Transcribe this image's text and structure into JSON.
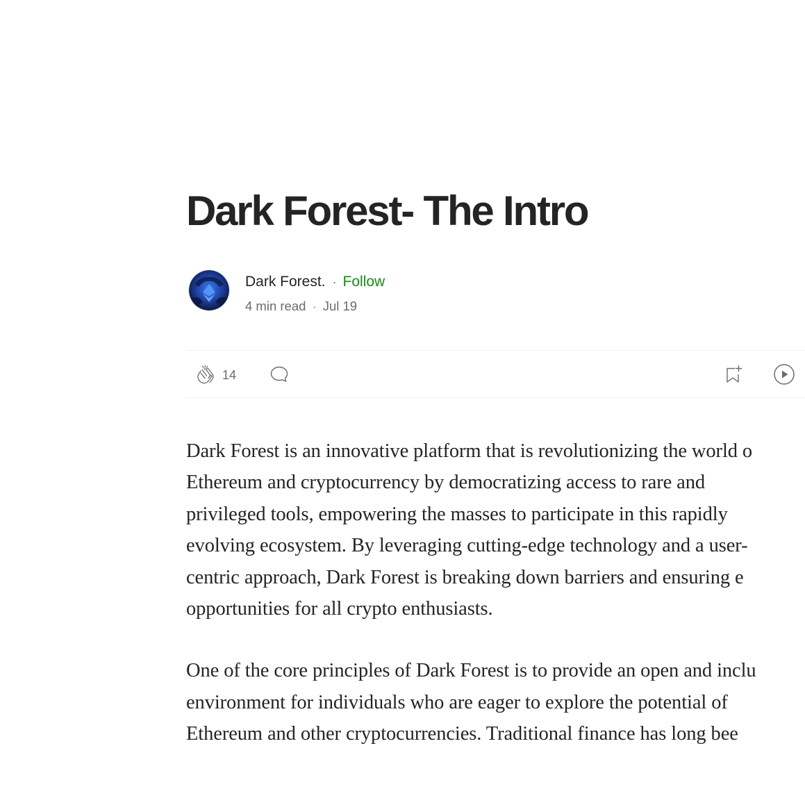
{
  "article": {
    "title": "Dark Forest- The Intro",
    "author": {
      "name": "Dark Forest.",
      "follow_label": "Follow",
      "avatar_icon": "avatar-image"
    },
    "meta": {
      "read_time": "4 min read",
      "date": "Jul 19",
      "separator": "·"
    },
    "actions": {
      "clap_icon": "clap-icon",
      "clap_count": "14",
      "response_icon": "comment-bubble-icon",
      "save_icon": "bookmark-add-icon",
      "listen_icon": "play-circle-icon"
    },
    "paragraphs": [
      {
        "lines": [
          "Dark Forest is an innovative platform that is revolutionizing the world o",
          "Ethereum and cryptocurrency by democratizing access to rare and",
          "privileged tools, empowering the masses to participate in this rapidly",
          "evolving ecosystem. By leveraging cutting-edge technology and a user-",
          "centric approach, Dark Forest is breaking down barriers and ensuring e",
          "opportunities for all crypto enthusiasts."
        ]
      },
      {
        "lines": [
          "One of the core principles of Dark Forest is to provide an open and inclu",
          "environment for individuals who are eager to explore the potential of",
          "Ethereum and other cryptocurrencies. Traditional finance has long bee"
        ]
      }
    ]
  },
  "colors": {
    "text": "#242424",
    "muted": "#6b6b6b",
    "follow_green": "#1a8917",
    "divider": "#f2f2f2"
  }
}
